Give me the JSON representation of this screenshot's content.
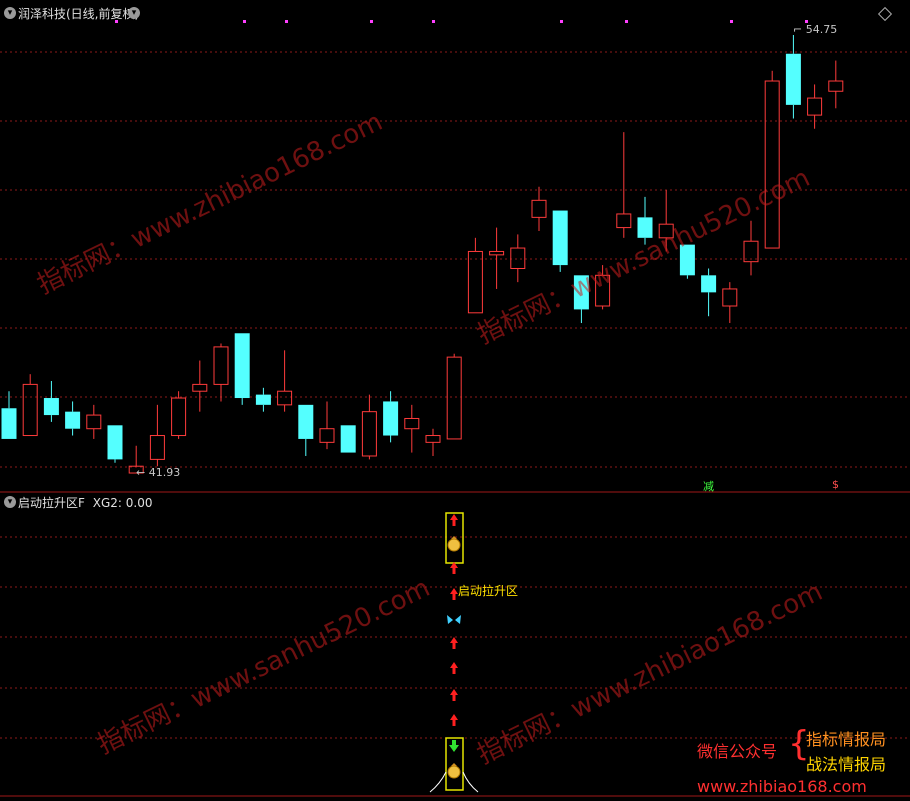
{
  "header": {
    "title": "润泽科技(日线,前复权)"
  },
  "indicator_header": {
    "name": "启动拉升区F",
    "field_label": "XG2:",
    "field_value": "0.00"
  },
  "price_annotations": {
    "high_label": "54.75",
    "low_label": "41.93"
  },
  "signal_text": "启动拉升区",
  "badges": {
    "reduce": "减",
    "money": "$"
  },
  "promo": {
    "left": "微信公众号",
    "right1": "指标情报局",
    "right2": "战法情报局",
    "url": "www.zhibiao168.com"
  },
  "watermarks": [
    "指标网：www.zhibiao168.com",
    "指标网：www.sanhu520.com"
  ],
  "colors": {
    "up": "#ff3b3b",
    "down": "#54ffff",
    "grid": "#8b1a1a",
    "marker": "#ff40ff"
  },
  "chart_data": {
    "type": "candlestick",
    "price_candles": [
      {
        "o": 43.8,
        "h": 44.3,
        "l": 42.9,
        "c": 42.9
      },
      {
        "o": 43.0,
        "h": 44.8,
        "l": 43.0,
        "c": 44.5
      },
      {
        "o": 44.1,
        "h": 44.6,
        "l": 43.4,
        "c": 43.6
      },
      {
        "o": 43.7,
        "h": 44.0,
        "l": 43.0,
        "c": 43.2
      },
      {
        "o": 43.2,
        "h": 43.9,
        "l": 42.9,
        "c": 43.6
      },
      {
        "o": 43.3,
        "h": 43.3,
        "l": 42.2,
        "c": 42.3
      },
      {
        "o": 41.9,
        "h": 42.7,
        "l": 41.9,
        "c": 42.1
      },
      {
        "o": 42.3,
        "h": 43.9,
        "l": 42.1,
        "c": 43.0
      },
      {
        "o": 43.0,
        "h": 44.3,
        "l": 42.9,
        "c": 44.1
      },
      {
        "o": 44.3,
        "h": 45.2,
        "l": 43.7,
        "c": 44.5
      },
      {
        "o": 44.5,
        "h": 45.7,
        "l": 44.0,
        "c": 45.6
      },
      {
        "o": 46.0,
        "h": 46.0,
        "l": 43.9,
        "c": 44.1
      },
      {
        "o": 44.2,
        "h": 44.4,
        "l": 43.7,
        "c": 43.9
      },
      {
        "o": 43.9,
        "h": 45.5,
        "l": 43.7,
        "c": 44.3
      },
      {
        "o": 43.9,
        "h": 43.9,
        "l": 42.4,
        "c": 42.9
      },
      {
        "o": 42.8,
        "h": 44.0,
        "l": 42.6,
        "c": 43.2
      },
      {
        "o": 43.3,
        "h": 43.3,
        "l": 42.5,
        "c": 42.5
      },
      {
        "o": 42.4,
        "h": 44.2,
        "l": 42.3,
        "c": 43.7
      },
      {
        "o": 44.0,
        "h": 44.3,
        "l": 42.8,
        "c": 43.0
      },
      {
        "o": 43.2,
        "h": 43.9,
        "l": 42.5,
        "c": 43.5
      },
      {
        "o": 42.8,
        "h": 43.2,
        "l": 42.4,
        "c": 43.0
      },
      {
        "o": 42.9,
        "h": 45.4,
        "l": 42.9,
        "c": 45.3
      },
      {
        "o": 46.6,
        "h": 48.8,
        "l": 46.6,
        "c": 48.4
      },
      {
        "o": 48.3,
        "h": 49.1,
        "l": 47.3,
        "c": 48.4
      },
      {
        "o": 47.9,
        "h": 48.9,
        "l": 47.5,
        "c": 48.5
      },
      {
        "o": 49.4,
        "h": 50.3,
        "l": 49.0,
        "c": 49.9
      },
      {
        "o": 49.6,
        "h": 49.6,
        "l": 47.8,
        "c": 48.0
      },
      {
        "o": 47.7,
        "h": 47.7,
        "l": 46.3,
        "c": 46.7
      },
      {
        "o": 46.8,
        "h": 48.0,
        "l": 46.7,
        "c": 47.7
      },
      {
        "o": 49.1,
        "h": 51.9,
        "l": 48.8,
        "c": 49.5
      },
      {
        "o": 49.4,
        "h": 50.0,
        "l": 48.6,
        "c": 48.8
      },
      {
        "o": 48.8,
        "h": 50.2,
        "l": 48.4,
        "c": 49.2
      },
      {
        "o": 48.6,
        "h": 48.6,
        "l": 47.6,
        "c": 47.7
      },
      {
        "o": 47.7,
        "h": 47.9,
        "l": 46.5,
        "c": 47.2
      },
      {
        "o": 46.8,
        "h": 47.5,
        "l": 46.3,
        "c": 47.3
      },
      {
        "o": 48.1,
        "h": 49.3,
        "l": 47.7,
        "c": 48.7
      },
      {
        "o": 48.5,
        "h": 53.7,
        "l": 48.5,
        "c": 53.4
      },
      {
        "o": 54.2,
        "h": 54.75,
        "l": 52.3,
        "c": 52.7
      },
      {
        "o": 52.4,
        "h": 53.3,
        "l": 52.0,
        "c": 52.9
      },
      {
        "o": 53.1,
        "h": 54.0,
        "l": 52.6,
        "c": 53.4
      }
    ],
    "indicator": {
      "name": "启动拉升区F",
      "XG2": 0.0
    }
  }
}
